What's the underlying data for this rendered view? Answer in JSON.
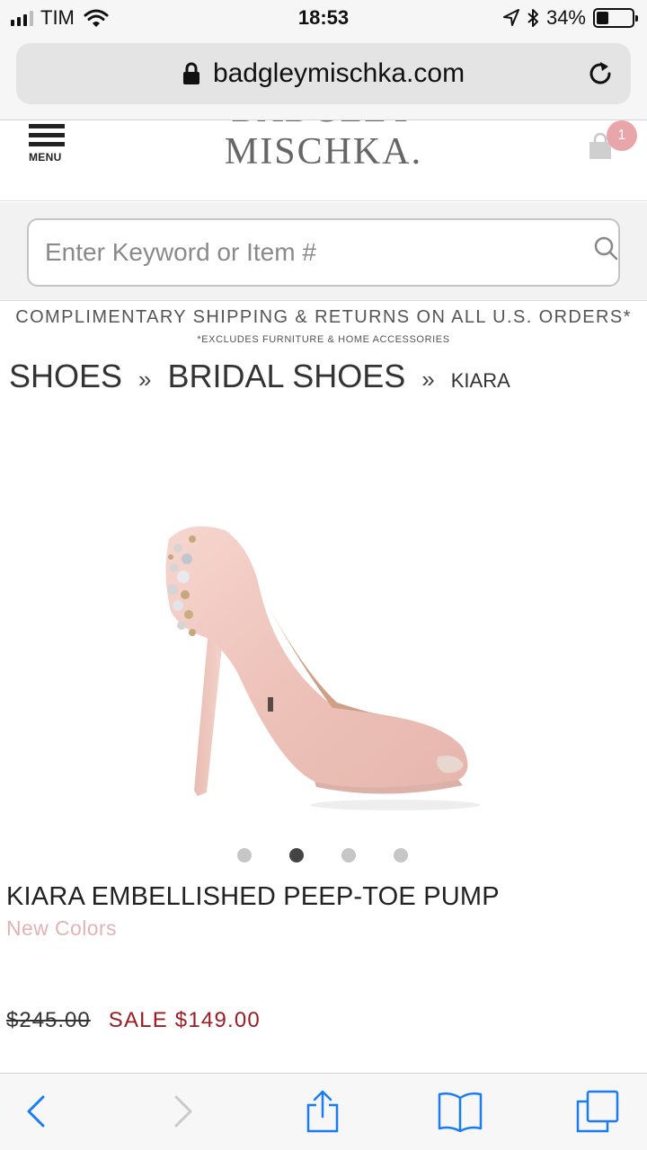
{
  "status_bar": {
    "carrier": "TIM",
    "time": "18:53",
    "battery_percent": "34%",
    "battery_level": 0.34,
    "icons": [
      "signal-icon",
      "wifi-icon",
      "location-arrow-icon",
      "bluetooth-icon",
      "battery-icon"
    ]
  },
  "browser": {
    "url": "badgleymischka.com",
    "icons": [
      "lock-icon",
      "reload-icon"
    ]
  },
  "header": {
    "menu_label": "MENU",
    "logo_top": "BADGLEY",
    "logo_bottom": "MISCHKA.",
    "cart_count": "1"
  },
  "search": {
    "placeholder": "Enter Keyword or Item #",
    "value": ""
  },
  "promo": {
    "main": "COMPLIMENTARY SHIPPING & RETURNS ON ALL U.S. ORDERS*",
    "sub": "*EXCLUDES FURNITURE & HOME ACCESSORIES"
  },
  "breadcrumb": {
    "items": [
      "SHOES",
      "BRIDAL SHOES",
      "KIARA"
    ],
    "separator": "»"
  },
  "product": {
    "title": "KIARA EMBELLISHED PEEP-TOE PUMP",
    "colors_label": "New Colors",
    "original_price": "$245.00",
    "sale_price": "SALE $149.00",
    "carousel_count": 4,
    "carousel_active": 2
  },
  "colors": {
    "sale_red": "#9b1c23",
    "colors_pink": "#e2b3b6",
    "badge_pink": "#e8a6ab",
    "ios_blue": "#1a7cf5"
  },
  "toolbar": {
    "icons": [
      "back-icon",
      "forward-icon",
      "share-icon",
      "bookmarks-icon",
      "tabs-icon"
    ]
  }
}
